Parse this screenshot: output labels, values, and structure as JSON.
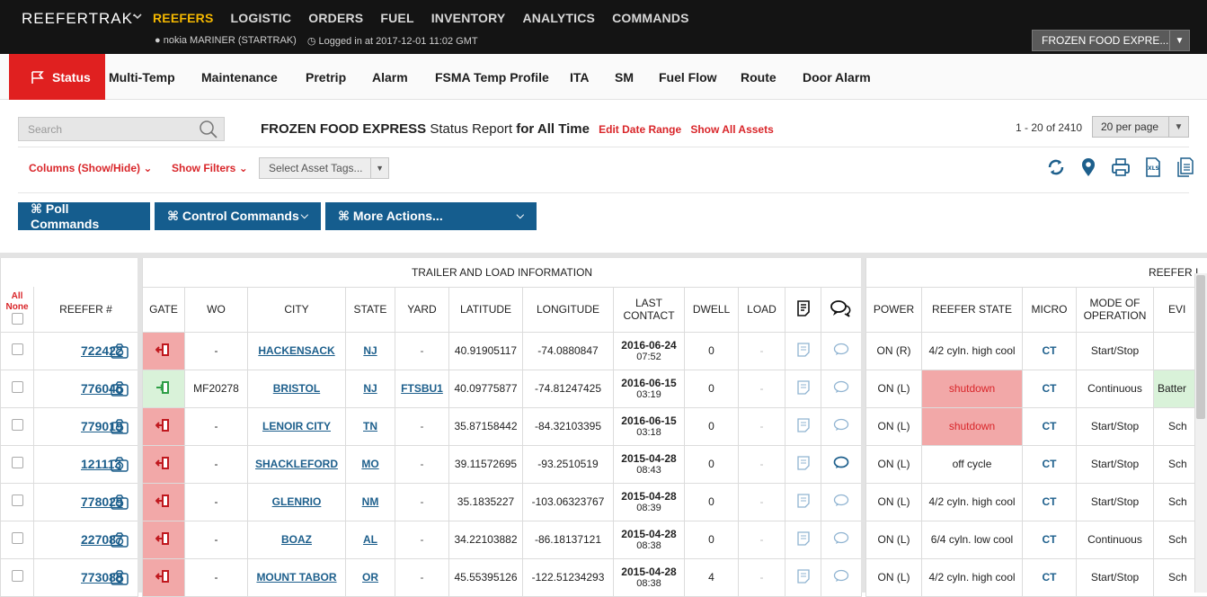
{
  "app": {
    "brand": "REEFERTRAK",
    "nav": [
      "REEFERS",
      "LOGISTIC",
      "ORDERS",
      "FUEL",
      "INVENTORY",
      "ANALYTICS",
      "COMMANDS"
    ],
    "user": "nokia MARINER (STARTRAK)",
    "login": "Logged in at 2017-12-01 11:02 GMT",
    "company_select": "FROZEN FOOD EXPRE..."
  },
  "tabs": [
    "Status",
    "Multi-Temp",
    "Maintenance",
    "Pretrip",
    "Alarm",
    "FSMA Temp Profile",
    "ITA",
    "SM",
    "Fuel Flow",
    "Route",
    "Door Alarm"
  ],
  "toolbar": {
    "search_placeholder": "Search",
    "company": "FROZEN FOOD EXPRESS",
    "report": "Status Report",
    "for_all_time": "for All Time",
    "edit_date_range": "Edit Date Range",
    "show_all_assets": "Show All Assets",
    "page_count": "1 - 20 of 2410",
    "per_page": "20 per page",
    "columns": "Columns (Show/Hide)",
    "show_filters": "Show Filters",
    "asset_tags": "Select Asset Tags...",
    "poll_commands": "⌘ Poll Commands",
    "control_commands": "⌘ Control Commands",
    "more_actions": "⌘ More Actions..."
  },
  "grid": {
    "group_trailer": "TRAILER AND LOAD INFORMATION",
    "group_reefer": "REEFER I",
    "all": "All",
    "none": "None",
    "headers": {
      "reefer": "REEFER #",
      "gate": "GATE",
      "wo": "WO",
      "city": "CITY",
      "state": "STATE",
      "yard": "YARD",
      "latitude": "LATITUDE",
      "longitude": "LONGITUDE",
      "last_contact_1": "LAST",
      "last_contact_2": "CONTACT",
      "dwell": "DWELL",
      "load": "LOAD",
      "power": "POWER",
      "reefer_state": "REEFER STATE",
      "micro": "MICRO",
      "mode_1": "MODE OF",
      "mode_2": "OPERATION",
      "ev": "EVI"
    },
    "rows": [
      {
        "reefer": "722422",
        "gate": "red",
        "wo": "-",
        "city": "HACKENSACK",
        "state": "NJ",
        "yard": "-",
        "lat": "40.91905117",
        "lon": "-74.0880847",
        "date": "2016-06-24",
        "time": "07:52",
        "dwell": "0",
        "load": "-",
        "chat_dark": false,
        "power": "ON (R)",
        "rstate": "4/2 cyln. high cool",
        "rstate_red": false,
        "micro": "CT",
        "mode": "Start/Stop",
        "ev": "",
        "ev_green": false
      },
      {
        "reefer": "776046",
        "gate": "green",
        "wo": "MF20278",
        "city": "BRISTOL",
        "state": "NJ",
        "yard": "FTSBU1",
        "lat": "40.09775877",
        "lon": "-74.81247425",
        "date": "2016-06-15",
        "time": "03:19",
        "dwell": "0",
        "load": "-",
        "chat_dark": false,
        "power": "ON (L)",
        "rstate": "shutdown",
        "rstate_red": true,
        "micro": "CT",
        "mode": "Continuous",
        "ev": "Batter",
        "ev_green": true
      },
      {
        "reefer": "779019",
        "gate": "red",
        "wo": "-",
        "city": "LENOIR CITY",
        "state": "TN",
        "yard": "-",
        "lat": "35.87158442",
        "lon": "-84.32103395",
        "date": "2016-06-15",
        "time": "03:18",
        "dwell": "0",
        "load": "-",
        "chat_dark": false,
        "power": "ON (L)",
        "rstate": "shutdown",
        "rstate_red": true,
        "micro": "CT",
        "mode": "Start/Stop",
        "ev": "Sch",
        "ev_green": false
      },
      {
        "reefer": "121113",
        "gate": "red",
        "wo": "-",
        "city": "SHACKLEFORD",
        "state": "MO",
        "yard": "-",
        "lat": "39.11572695",
        "lon": "-93.2510519",
        "date": "2015-04-28",
        "time": "08:43",
        "dwell": "0",
        "load": "-",
        "chat_dark": true,
        "power": "ON (L)",
        "rstate": "off cycle",
        "rstate_red": false,
        "micro": "CT",
        "mode": "Start/Stop",
        "ev": "Sch",
        "ev_green": false
      },
      {
        "reefer": "778029",
        "gate": "red",
        "wo": "-",
        "city": "GLENRIO",
        "state": "NM",
        "yard": "-",
        "lat": "35.1835227",
        "lon": "-103.06323767",
        "date": "2015-04-28",
        "time": "08:39",
        "dwell": "0",
        "load": "-",
        "chat_dark": false,
        "power": "ON (L)",
        "rstate": "4/2 cyln. high cool",
        "rstate_red": false,
        "micro": "CT",
        "mode": "Start/Stop",
        "ev": "Sch",
        "ev_green": false
      },
      {
        "reefer": "227087",
        "gate": "red",
        "wo": "-",
        "city": "BOAZ",
        "state": "AL",
        "yard": "-",
        "lat": "34.22103882",
        "lon": "-86.18137121",
        "date": "2015-04-28",
        "time": "08:38",
        "dwell": "0",
        "load": "-",
        "chat_dark": false,
        "power": "ON (L)",
        "rstate": "6/4 cyln. low cool",
        "rstate_red": false,
        "micro": "CT",
        "mode": "Continuous",
        "ev": "Sch",
        "ev_green": false
      },
      {
        "reefer": "773088",
        "gate": "red",
        "wo": "-",
        "city": "MOUNT TABOR",
        "state": "OR",
        "yard": "-",
        "lat": "45.55395126",
        "lon": "-122.51234293",
        "date": "2015-04-28",
        "time": "08:38",
        "dwell": "4",
        "load": "-",
        "chat_dark": false,
        "power": "ON (L)",
        "rstate": "4/2 cyln. high cool",
        "rstate_red": false,
        "micro": "CT",
        "mode": "Start/Stop",
        "ev": "Sch",
        "ev_green": false
      }
    ]
  }
}
